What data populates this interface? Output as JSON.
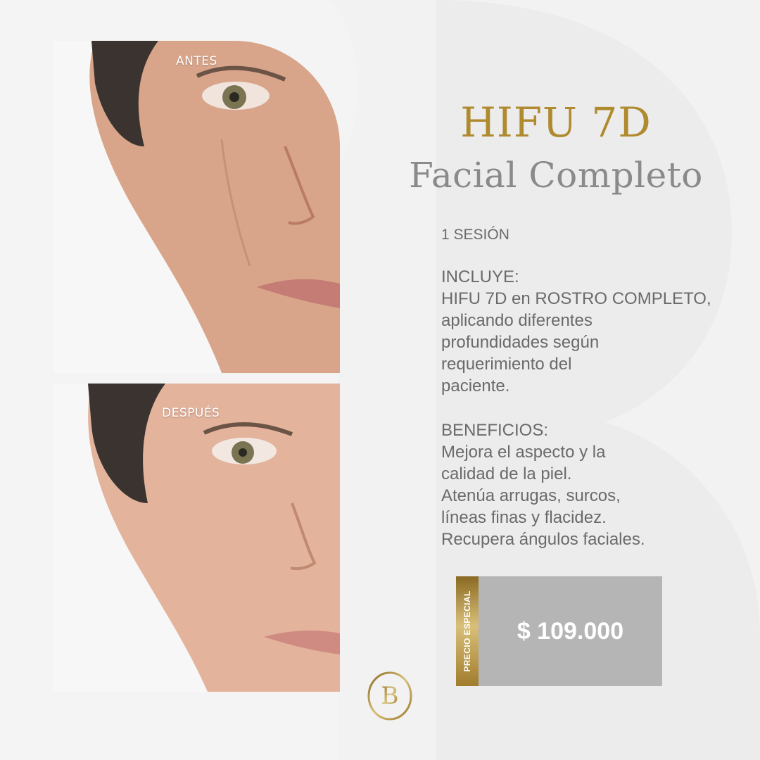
{
  "photos": {
    "before_label": "ANTES",
    "after_label": "DESPUÉS"
  },
  "title": {
    "main": "HIFU 7D",
    "sub": "Facial Completo"
  },
  "details": {
    "sessions": "1 SESIÓN",
    "includes_heading": "INCLUYE:",
    "includes_lines": [
      "HIFU 7D en ROSTRO COMPLETO,",
      "aplicando diferentes",
      "profundidades según",
      "requerimiento del",
      "paciente."
    ],
    "benefits_heading": "BENEFICIOS:",
    "benefits_lines": [
      "Mejora el aspecto y la",
      "calidad de la piel.",
      "Atenúa arrugas, surcos,",
      "líneas finas y flacidez.",
      "Recupera ángulos faciales."
    ]
  },
  "price": {
    "band_label": "PRECIO ESPECIAL",
    "value": "$ 109.000"
  },
  "logo": {
    "letter": "B"
  },
  "colors": {
    "gold": "#b08a2e",
    "gray_text": "#6a6a6a",
    "price_bg": "#b5b5b5",
    "background": "#f2f2f2"
  }
}
